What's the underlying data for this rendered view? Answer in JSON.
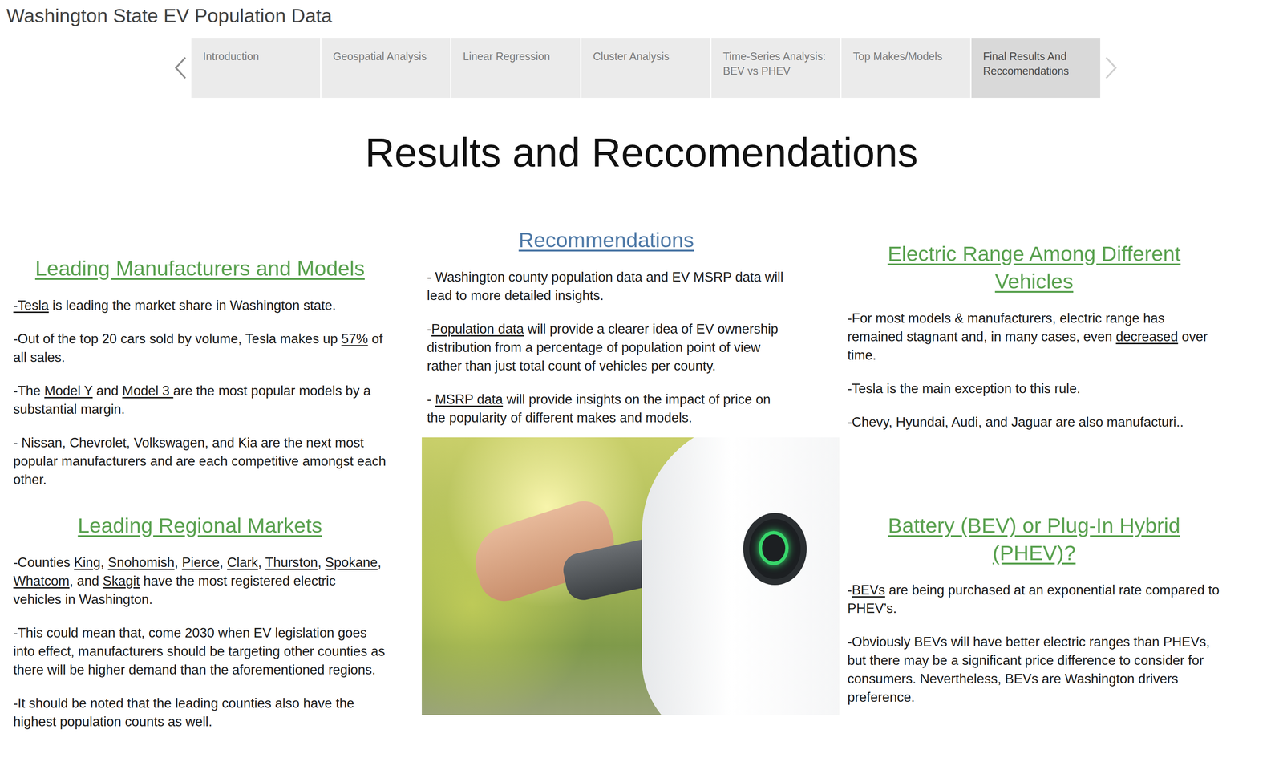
{
  "window": {
    "title": "Washington State EV Population Data"
  },
  "nav": {
    "prev_enabled": true,
    "next_enabled": false
  },
  "tabs": [
    {
      "label": "Introduction",
      "selected": false
    },
    {
      "label": "Geospatial Analysis",
      "selected": false
    },
    {
      "label": "Linear Regression",
      "selected": false
    },
    {
      "label": "Cluster Analysis",
      "selected": false
    },
    {
      "label": "Time-Series Analysis: BEV vs PHEV",
      "selected": false
    },
    {
      "label": "Top Makes/Models",
      "selected": false
    },
    {
      "label": "Final Results And Reccomendations",
      "selected": true
    }
  ],
  "page_title": "Results and Reccomendations",
  "columns": [
    {
      "items": [
        {
          "kind": "finding",
          "heading": "Leading Manufacturers and Models",
          "paragraphs": [
            [
              {
                "text": "-Tesla",
                "underline": true
              },
              {
                "text": " is leading the market share in Washington state.",
                "underline": false
              }
            ],
            [
              {
                "text": "-Out of the top 20 cars sold by volume, Tesla makes up ",
                "underline": false
              },
              {
                "text": "57%",
                "underline": true
              },
              {
                "text": " of all sales.",
                "underline": false
              }
            ],
            [
              {
                "text": "-The ",
                "underline": false
              },
              {
                "text": "Model Y",
                "underline": true
              },
              {
                "text": " and ",
                "underline": false
              },
              {
                "text": "Model 3 ",
                "underline": true
              },
              {
                "text": "are the most popular models by a substantial margin.",
                "underline": false
              }
            ],
            [
              {
                "text": "- Nissan, Chevrolet, Volkswagen, and Kia are the next most popular manufacturers and are each competitive amongst each other.",
                "underline": false
              }
            ]
          ]
        },
        {
          "kind": "finding",
          "heading": "Leading Regional Markets",
          "paragraphs": [
            [
              {
                "text": "-Counties ",
                "underline": false
              },
              {
                "text": "King",
                "underline": true
              },
              {
                "text": ", ",
                "underline": false
              },
              {
                "text": "Snohomish",
                "underline": true
              },
              {
                "text": ", ",
                "underline": false
              },
              {
                "text": "Pierce",
                "underline": true
              },
              {
                "text": ", ",
                "underline": false
              },
              {
                "text": "Clark",
                "underline": true
              },
              {
                "text": ", ",
                "underline": false
              },
              {
                "text": "Thurston",
                "underline": true
              },
              {
                "text": ", ",
                "underline": false
              },
              {
                "text": "Spokane",
                "underline": true
              },
              {
                "text": ", ",
                "underline": false
              },
              {
                "text": "Whatcom",
                "underline": true
              },
              {
                "text": ", and ",
                "underline": false
              },
              {
                "text": "Skagit",
                "underline": true
              },
              {
                "text": " have the most registered electric vehicles in Washington.",
                "underline": false
              }
            ],
            [
              {
                "text": "-This could mean that, come 2030 when EV legislation goes into effect, manufacturers should be targeting other counties as there will be higher demand than the aforementioned regions.",
                "underline": false
              }
            ],
            [
              {
                "text": "-It should be noted that the leading counties also have the highest population counts as well.",
                "underline": false
              }
            ]
          ]
        }
      ]
    },
    {
      "items": [
        {
          "kind": "recommendation",
          "heading": "Recommendations",
          "paragraphs": [
            [
              {
                "text": "- Washington county population data and EV MSRP data will lead to more detailed insights.",
                "underline": false
              }
            ],
            [
              {
                "text": "-",
                "underline": false
              },
              {
                "text": "Population data",
                "underline": true
              },
              {
                "text": " will provide a clearer idea of EV ownership distribution from a percentage of population point of view rather than just total count of vehicles per county.",
                "underline": false
              }
            ],
            [
              {
                "text": "- ",
                "underline": false
              },
              {
                "text": "MSRP data",
                "underline": true
              },
              {
                "text": " will provide insights on the impact of price on the popularity of different makes and models.",
                "underline": false
              }
            ]
          ]
        },
        {
          "kind": "photo"
        }
      ]
    },
    {
      "items": [
        {
          "kind": "finding",
          "heading": "Electric Range Among Different Vehicles",
          "paragraphs": [
            [
              {
                "text": "-For most models & manufacturers, electric range has remained stagnant and, in many cases, even ",
                "underline": false
              },
              {
                "text": "decreased",
                "underline": true
              },
              {
                "text": " over time.",
                "underline": false
              }
            ],
            [
              {
                "text": "-Tesla is the main exception to this rule.",
                "underline": false
              }
            ],
            [
              {
                "text": "-Chevy, Hyundai, Audi, and Jaguar are also manufacturi..",
                "underline": false
              }
            ]
          ]
        },
        {
          "kind": "finding",
          "heading": "Battery (BEV) or Plug-In Hybrid (PHEV)?",
          "paragraphs": [
            [
              {
                "text": "-",
                "underline": false
              },
              {
                "text": "BEVs",
                "underline": true
              },
              {
                "text": " are being purchased at an exponential rate compared to PHEV’s.",
                "underline": false
              }
            ],
            [
              {
                "text": "-Obviously BEVs will have better electric ranges than PHEVs, but there may be a significant price difference to consider for consumers. Nevertheless, BEVs are Washington drivers preference.",
                "underline": false
              }
            ]
          ]
        }
      ]
    }
  ]
}
